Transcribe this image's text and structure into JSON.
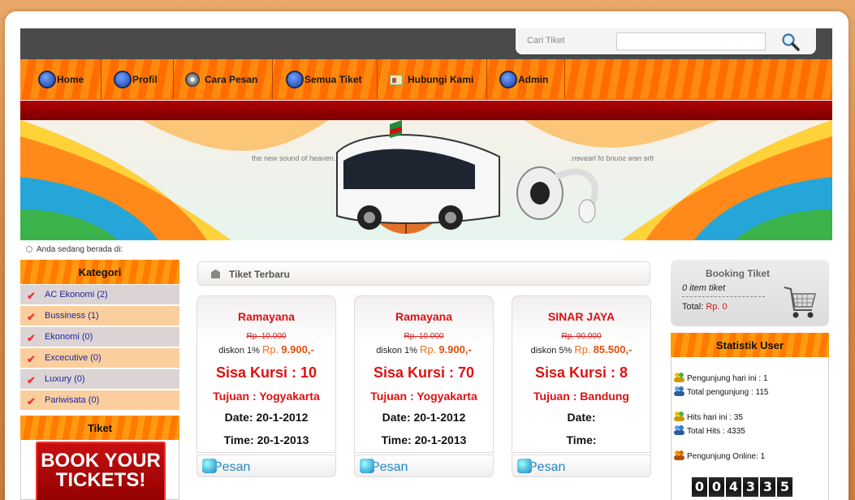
{
  "search": {
    "label": "Cari Tiket",
    "value": "",
    "icon": "magnifier-icon"
  },
  "nav": [
    {
      "label": "Home",
      "icon": "home-icon"
    },
    {
      "label": "Profil",
      "icon": "profile-icon"
    },
    {
      "label": "Cara Pesan",
      "icon": "cd-icon"
    },
    {
      "label": "Semua Tiket",
      "icon": "ticket-icon"
    },
    {
      "label": "Hubungi Kami",
      "icon": "contact-card-icon"
    },
    {
      "label": "Admin",
      "icon": "admin-icon"
    }
  ],
  "banner": {
    "slogan": "the new sound of heaven."
  },
  "breadcrumb": "Anda sedang berada di:",
  "kategori": {
    "title": "Kategori",
    "items": [
      "AC Ekonomi (2)",
      "Bussiness (1)",
      "Ekonomi (0)",
      "Excecutive (0)",
      "Luxury (0)",
      "Pariwisata (0)"
    ]
  },
  "tiket": {
    "title": "Tiket",
    "banner_text": "BOOK YOUR TICKETS!"
  },
  "latest": {
    "title": "Tiket Terbaru",
    "cards": [
      {
        "name": "Ramayana",
        "old": "Rp. 10.000",
        "disc": "diskon 1%",
        "rp": "Rp.",
        "price": "9.900,-",
        "seat": "Sisa Kursi : 10",
        "dest": "Tujuan : Yogyakarta",
        "date": "Date: 20-1-2012",
        "time": "Time: 20-1-2013",
        "action": "Pesan"
      },
      {
        "name": "Ramayana",
        "old": "Rp. 10.000",
        "disc": "diskon 1%",
        "rp": "Rp.",
        "price": "9.900,-",
        "seat": "Sisa Kursi : 70",
        "dest": "Tujuan : Yogyakarta",
        "date": "Date: 20-1-2012",
        "time": "Time: 20-1-2013",
        "action": "Pesan"
      },
      {
        "name": "SINAR JAYA",
        "old": "Rp. 90.000",
        "disc": "diskon 5%",
        "rp": "Rp.",
        "price": "85.500,-",
        "seat": "Sisa Kursi : 8",
        "dest": "Tujuan : Bandung",
        "date": "Date:",
        "time": "Time:",
        "action": "Pesan"
      }
    ]
  },
  "booking": {
    "title": "Booking Tiket",
    "items": "0 item tiket",
    "total_label": "Total:",
    "total_value": "Rp. 0"
  },
  "stats": {
    "title": "Statistik User",
    "visitors_today": "Pengunjung hari ini : 1",
    "visitors_total": "Total pengunjung : 115",
    "hits_today": "Hits hari ini : 35",
    "hits_total": "Total Hits : 4335",
    "online": "Pengunjung Online: 1",
    "counter": [
      "0",
      "0",
      "4",
      "3",
      "3",
      "5"
    ]
  }
}
